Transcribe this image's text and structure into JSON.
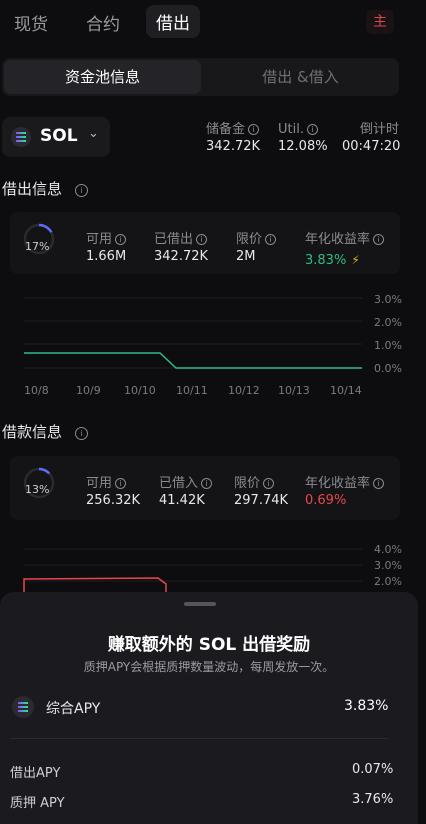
{
  "tabs": {
    "spot": "现货",
    "contract": "合约",
    "lending": "借出",
    "avatar": "主"
  },
  "segmented": {
    "pool_info": "资金池信息",
    "lend_borrow": "借出 &借入"
  },
  "asset": {
    "symbol": "SOL"
  },
  "summary": {
    "reserve_label": "储备金",
    "reserve_value": "342.72K",
    "util_label": "Util.",
    "util_value": "12.08%",
    "countdown_label": "倒计时",
    "countdown_value": "00:47:20"
  },
  "lend": {
    "title": "借出信息",
    "ring_pct": "17%",
    "ring_fraction": 0.17,
    "available_label": "可用",
    "available_value": "1.66M",
    "lent_label": "已借出",
    "lent_value": "342.72K",
    "limit_label": "限价",
    "limit_value": "2M",
    "apy_label": "年化收益率",
    "apy_value": "3.83%",
    "chart": {
      "y_ticks": [
        "3.0%",
        "2.0%",
        "1.0%",
        "0.0%"
      ],
      "x_ticks": [
        "10/8",
        "10/9",
        "10/10",
        "10/11",
        "10/12",
        "10/13",
        "10/14"
      ]
    }
  },
  "borrow": {
    "title": "借款信息",
    "ring_pct": "13%",
    "ring_fraction": 0.13,
    "available_label": "可用",
    "available_value": "256.32K",
    "borrowed_label": "已借入",
    "borrowed_value": "41.42K",
    "limit_label": "限价",
    "limit_value": "297.74K",
    "apy_label": "年化收益率",
    "apy_value": "0.69%",
    "chart": {
      "y_ticks": [
        "4.0%",
        "3.0%",
        "2.0%"
      ]
    }
  },
  "sheet": {
    "title": "赚取额外的 SOL 出借奖励",
    "subtitle": "质押APY会根据质押数量波动，每周发放一次。",
    "total_label": "综合APY",
    "total_value": "3.83%",
    "lend_apy_label": "借出APY",
    "lend_apy_value": "0.07%",
    "stake_apy_label": "质押 APY",
    "stake_apy_value": "3.76%"
  },
  "colors": {
    "green": "#2ebd85",
    "red": "#e5484d",
    "accent": "#5b6cff"
  }
}
